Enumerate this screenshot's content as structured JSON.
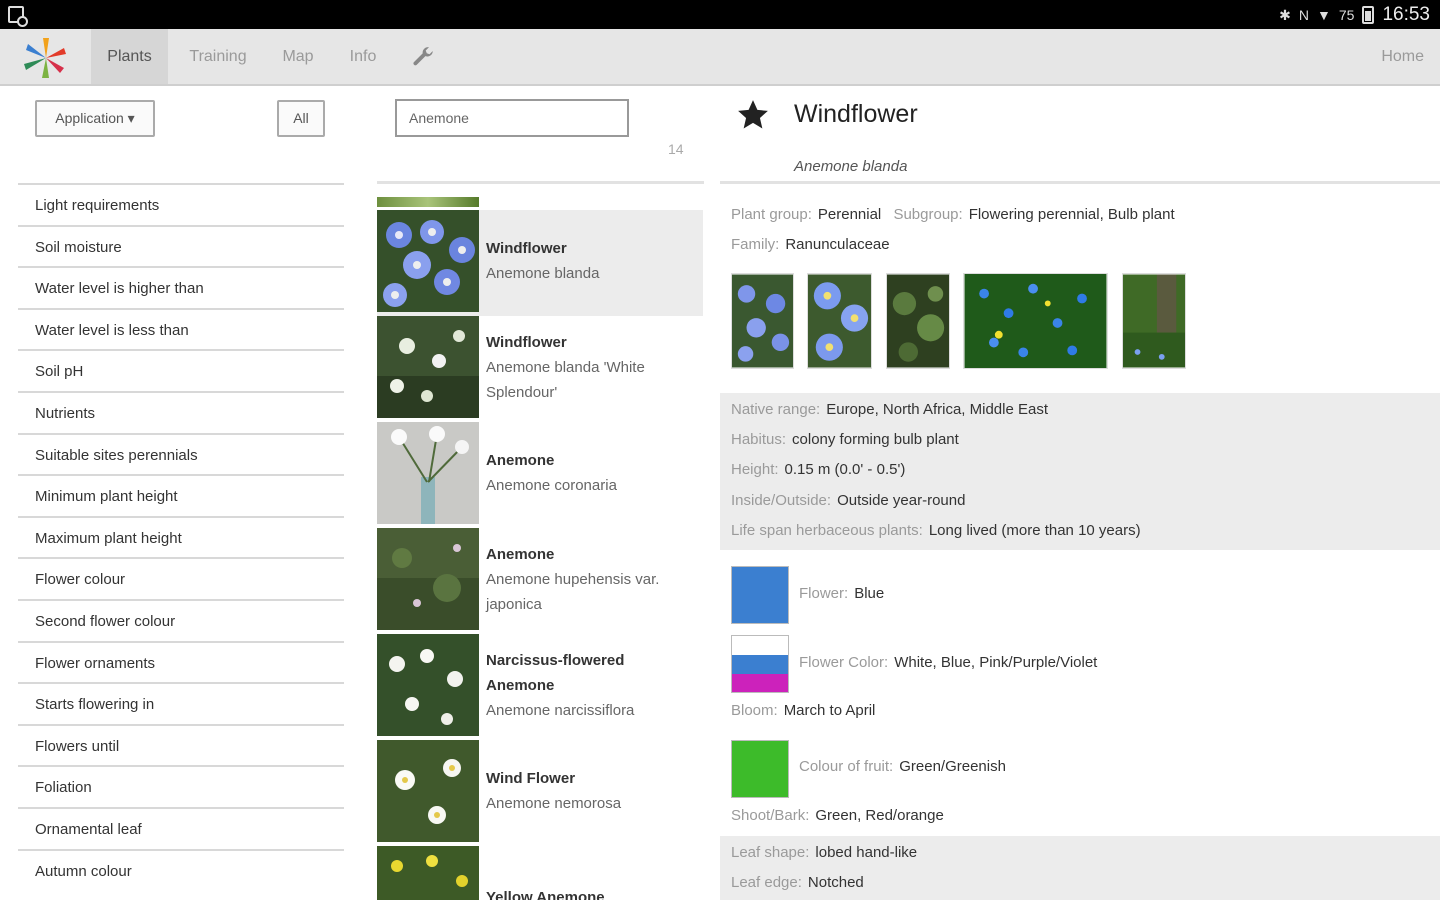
{
  "status_bar": {
    "time": "16:53",
    "battery": "75"
  },
  "nav": {
    "tabs": [
      "Plants",
      "Training",
      "Map",
      "Info"
    ],
    "home": "Home"
  },
  "filters": {
    "application_button": "Application ▾",
    "all_button": "All",
    "items": [
      "Light requirements",
      "Soil moisture",
      "Water level is higher than",
      "Water level is less than",
      "Soil pH",
      "Nutrients",
      "Suitable sites perennials",
      "Minimum plant height",
      "Maximum plant height",
      "Flower colour",
      "Second flower colour",
      "Flower ornaments",
      "Starts flowering in",
      "Flowers until",
      "Foliation",
      "Ornamental leaf",
      "Autumn colour"
    ]
  },
  "search": {
    "value": "Anemone",
    "count": "14"
  },
  "plants": [
    {
      "common": "Windflower",
      "latin": "Anemone blanda"
    },
    {
      "common": "Windflower",
      "latin": "Anemone blanda 'White Splendour'"
    },
    {
      "common": "Anemone",
      "latin": "Anemone coronaria"
    },
    {
      "common": "Anemone",
      "latin": "Anemone hupehensis var. japonica"
    },
    {
      "common": "Narcissus-flowered Anemone",
      "latin": "Anemone narcissiflora"
    },
    {
      "common": "Wind Flower",
      "latin": "Anemone nemorosa"
    },
    {
      "common": "Yellow Anemone",
      "latin": ""
    }
  ],
  "detail": {
    "title": "Windflower",
    "latin": "Anemone blanda",
    "plant_group_label": "Plant group:",
    "plant_group": "Perennial",
    "subgroup_label": "Subgroup:",
    "subgroup": "Flowering perennial, Bulb plant",
    "family_label": "Family:",
    "family": "Ranunculaceae",
    "native_range_label": "Native range:",
    "native_range": "Europe, North Africa, Middle East",
    "habitus_label": "Habitus:",
    "habitus": "colony forming bulb plant",
    "height_label": "Height:",
    "height": "0.15 m (0.0' - 0.5')",
    "inside_outside_label": "Inside/Outside:",
    "inside_outside": "Outside year-round",
    "life_span_label": "Life span herbaceous plants:",
    "life_span": "Long lived (more than 10 years)",
    "flower_label": "Flower:",
    "flower": "Blue",
    "flower_color_label": "Flower Color:",
    "flower_color": "White, Blue, Pink/Purple/Violet",
    "bloom_label": "Bloom:",
    "bloom": "March to April",
    "fruit_label": "Colour of fruit:",
    "fruit": "Green/Greenish",
    "shoot_label": "Shoot/Bark:",
    "shoot": "Green, Red/orange",
    "leaf_shape_label": "Leaf shape:",
    "leaf_shape": "lobed hand-like",
    "leaf_edge_label": "Leaf edge:",
    "leaf_edge": "Notched"
  },
  "colors": {
    "flower_blue": "#3b7fd0",
    "white": "#ffffff",
    "blue": "#3b7fd0",
    "magenta": "#cc22bb",
    "fruit_green": "#3dbb2a"
  }
}
